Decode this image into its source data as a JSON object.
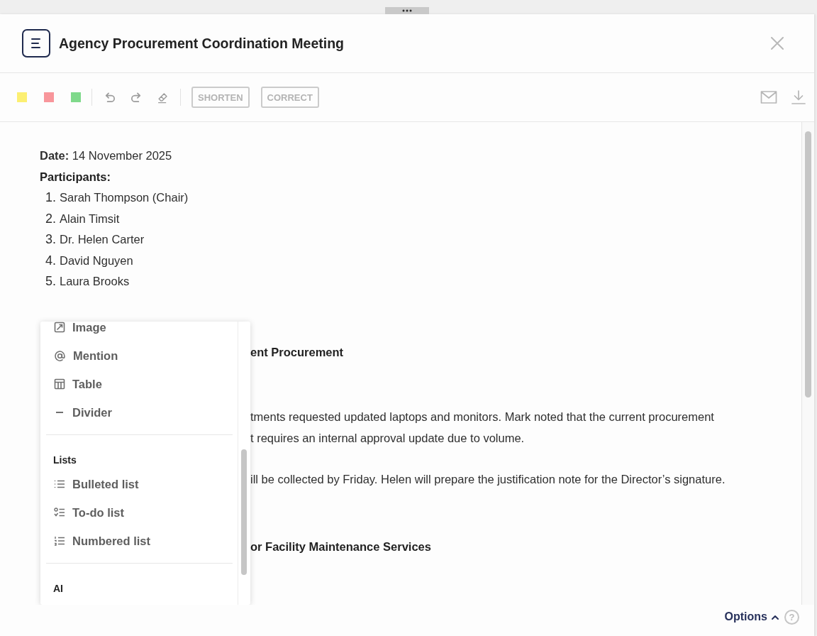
{
  "header": {
    "title": "Agency Procurement Coordination Meeting"
  },
  "toolbar": {
    "highlight_colors": [
      {
        "color": "#fcef72"
      },
      {
        "color": "#f8969b"
      },
      {
        "color": "#7fd98b"
      }
    ],
    "actions": [
      "SHORTEN",
      "CORRECT"
    ]
  },
  "document": {
    "date_line": "**Date:** 14 November 2025",
    "participants_label": "Participants:",
    "participants": [
      {
        "number": "1.",
        "name": "Sarah Thompson (Chair)"
      },
      {
        "number": "2.",
        "name": "Alain Timsit"
      },
      {
        "number": "3.",
        "name": "Dr. Helen Carter"
      },
      {
        "number": "4.",
        "name": "David Nguyen"
      },
      {
        "number": "5.",
        "name": "Laura Brooks"
      }
    ],
    "sections": [
      {
        "heading": "ent Procurement",
        "paragraphs": [
          {
            "lines": [
              "tments requested updated laptops and monitors. Mark noted that the current procurement",
              "t requires an internal approval update due to volume."
            ]
          },
          {
            "lines": [
              "ill be collected by Friday. Helen will prepare the justification note for the Director’s signature."
            ]
          }
        ]
      },
      {
        "heading": "or Facility Maintenance Services"
      }
    ]
  },
  "insert_menu": {
    "sections": [
      {
        "items": [
          {
            "kind": "image",
            "label": "Image"
          },
          {
            "kind": "mention",
            "label": "Mention"
          },
          {
            "kind": "table",
            "label": "Table"
          },
          {
            "kind": "divider",
            "label": "Divider"
          }
        ]
      },
      {
        "heading": "Lists",
        "items": [
          {
            "kind": "bulleted",
            "label": "Bulleted list"
          },
          {
            "kind": "todo",
            "label": "To-do list"
          },
          {
            "kind": "numbered",
            "label": "Numbered list"
          }
        ]
      },
      {
        "heading": "AI"
      }
    ]
  },
  "footer": {
    "options_label": "Options",
    "help": "?"
  }
}
